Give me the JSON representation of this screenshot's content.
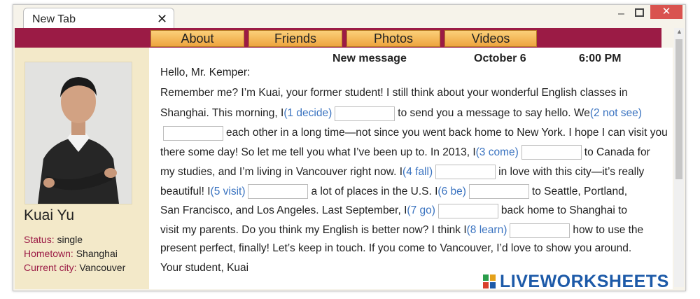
{
  "window": {
    "tab_title": "New Tab",
    "close_glyph": "✕",
    "minimize_glyph": "–",
    "close_window_glyph": "✕"
  },
  "nav": {
    "items": [
      "About",
      "Friends",
      "Photos",
      "Videos"
    ]
  },
  "profile": {
    "name": "Kuai Yu",
    "status_label": "Status:",
    "status_value": "single",
    "hometown_label": "Hometown:",
    "hometown_value": "Shanghai",
    "city_label": "Current city:",
    "city_value": "Vancouver"
  },
  "message": {
    "heading": "New message",
    "date": "October 6",
    "time": "6:00 PM",
    "greeting": "Hello, Mr. Kemper:",
    "lines": [
      {
        "segments": [
          {
            "t": "Remember me? I’m Kuai, your former student! I still think about your wonderful English classes in"
          }
        ]
      },
      {
        "segments": [
          {
            "t": "Shanghai. This morning, I "
          },
          {
            "h": "(1 decide)"
          },
          {
            "b": 1
          },
          {
            "t": " to send you a message to say hello. We "
          },
          {
            "h": "(2 not see)"
          }
        ]
      },
      {
        "segments": [
          {
            "b": 2
          },
          {
            "t": " each other in a long time—not since you went back home to New York. I hope I can visit you"
          }
        ]
      },
      {
        "segments": [
          {
            "t": "there some day! So let me tell you what I’ve been up to. In 2013, I "
          },
          {
            "h": "(3 come)"
          },
          {
            "b": 3
          },
          {
            "t": " to Canada for"
          }
        ]
      },
      {
        "segments": [
          {
            "t": "my studies, and I’m living in Vancouver right now. I "
          },
          {
            "h": "(4 fall)"
          },
          {
            "b": 4
          },
          {
            "t": " in love with this city—it’s really"
          }
        ]
      },
      {
        "segments": [
          {
            "t": "beautiful! I "
          },
          {
            "h": "(5 visit)"
          },
          {
            "b": 5
          },
          {
            "t": " a lot of places in the U.S. I "
          },
          {
            "h": "(6 be)"
          },
          {
            "b": 6
          },
          {
            "t": " to Seattle, Portland,"
          }
        ]
      },
      {
        "segments": [
          {
            "t": "San Francisco, and Los Angeles. Last September, I "
          },
          {
            "h": "(7 go)"
          },
          {
            "b": 7
          },
          {
            "t": " back home to Shanghai to"
          }
        ]
      },
      {
        "segments": [
          {
            "t": "visit my parents. Do you think my English is better now? I think I "
          },
          {
            "h": "(8 learn)"
          },
          {
            "b": 8
          },
          {
            "t": " how to use the"
          }
        ]
      },
      {
        "segments": [
          {
            "t": "present perfect, finally! Let’s keep in touch. If you come to Vancouver, I’d love to show you around."
          }
        ]
      }
    ],
    "signoff": "Your student, Kuai"
  },
  "watermark": "LIVEWORKSHEETS",
  "colors": {
    "accent": "#9b1b45",
    "hint": "#3a73c0",
    "button": "#f3b450"
  }
}
